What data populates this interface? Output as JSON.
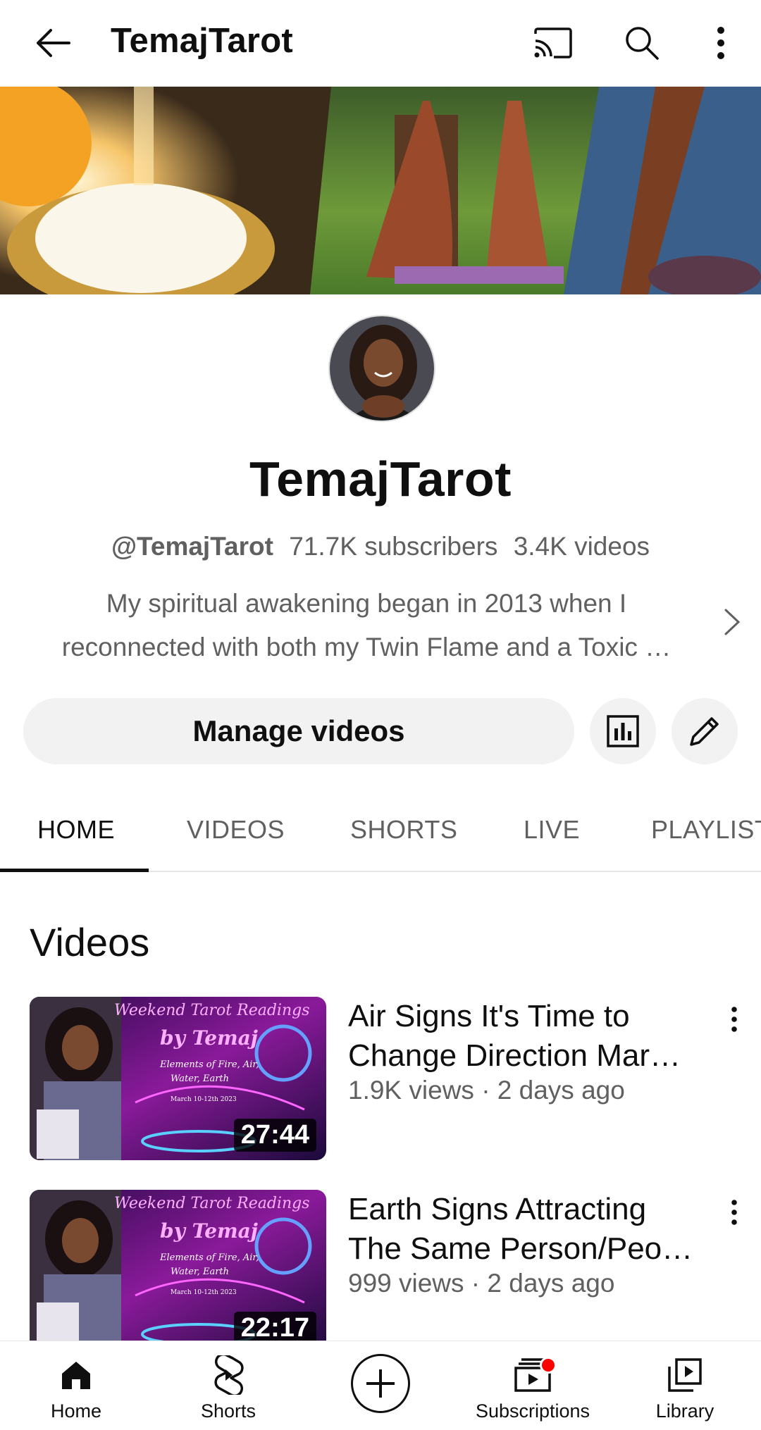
{
  "header": {
    "title": "TemajTarot",
    "back_icon": "arrow-left-icon",
    "cast_icon": "cast-icon",
    "search_icon": "search-icon",
    "more_icon": "more-vert-icon"
  },
  "channel": {
    "name": "TemajTarot",
    "handle": "@TemajTarot",
    "subscribers": "71.7K subscribers",
    "videos": "3.4K videos",
    "description_line1": "My spiritual awakening began in 2013 when I",
    "description_line2": "reconnected with both my Twin Flame and a Toxic …"
  },
  "actions": {
    "manage_label": "Manage videos",
    "analytics_icon": "analytics-icon",
    "edit_icon": "edit-pencil-icon"
  },
  "tabs": [
    {
      "label": "HOME",
      "active": true
    },
    {
      "label": "VIDEOS",
      "active": false
    },
    {
      "label": "SHORTS",
      "active": false
    },
    {
      "label": "LIVE",
      "active": false
    },
    {
      "label": "PLAYLISTS",
      "active": false
    }
  ],
  "videos_section": {
    "title": "Videos",
    "items": [
      {
        "title": "Air Signs It's Time to Change Direction Mar…",
        "title_line1": "Air Signs It's Time to",
        "title_line2": "Change Direction Mar…",
        "meta": "1.9K views · 2 days ago",
        "duration": "27:44",
        "thumb_text1": "Weekend Tarot Readings",
        "thumb_text2": "by Temaj",
        "thumb_text3": "Elements of Fire, Air,",
        "thumb_text4": "Water, Earth",
        "thumb_text5": "March 10-12th 2023"
      },
      {
        "title": "Earth Signs Attracting The Same Person/Peo…",
        "title_line1": "Earth Signs Attracting",
        "title_line2": "The Same Person/Peo…",
        "meta": "999 views · 2 days ago",
        "duration": "22:17",
        "thumb_text1": "Weekend Tarot Readings",
        "thumb_text2": "by Temaj",
        "thumb_text3": "Elements of Fire, Air,",
        "thumb_text4": "Water, Earth",
        "thumb_text5": "March 10-12th 2023"
      }
    ]
  },
  "bottom_nav": {
    "home": "Home",
    "shorts": "Shorts",
    "subscriptions": "Subscriptions",
    "library": "Library",
    "create_icon": "plus-circle-icon"
  },
  "colors": {
    "text_primary": "#0f0f0f",
    "text_secondary": "#606060",
    "button_bg": "#f2f2f2",
    "notification_dot": "#ff0000"
  }
}
